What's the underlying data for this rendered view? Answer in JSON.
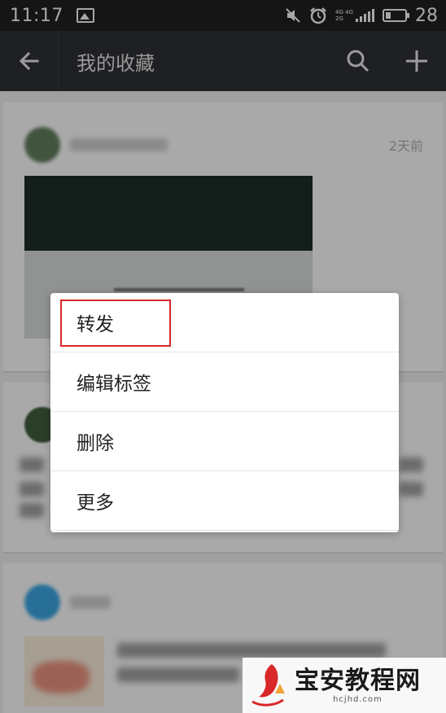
{
  "status_bar": {
    "time": "11:17",
    "network_top": "4G 4G",
    "network_bottom": "2G",
    "battery": "28"
  },
  "header": {
    "title": "我的收藏"
  },
  "list": {
    "items": [
      {
        "time": "2天前"
      },
      {
        "time": ""
      },
      {
        "time": ""
      }
    ]
  },
  "context_menu": {
    "items": [
      {
        "label": "转发",
        "highlighted": true
      },
      {
        "label": "编辑标签"
      },
      {
        "label": "删除"
      },
      {
        "label": "更多"
      }
    ]
  },
  "watermark": {
    "name": "宝安教程网",
    "url": "hcjhd.com"
  },
  "colors": {
    "app_bar": "#2b2e33",
    "status_bar": "#1f1f1f",
    "highlight": "#d9282a",
    "watermark_logo": "#d9282a"
  },
  "icons": [
    "image-icon",
    "mute-icon",
    "alarm-icon",
    "signal-icon",
    "battery-icon",
    "back-arrow-icon",
    "search-icon",
    "add-icon"
  ]
}
